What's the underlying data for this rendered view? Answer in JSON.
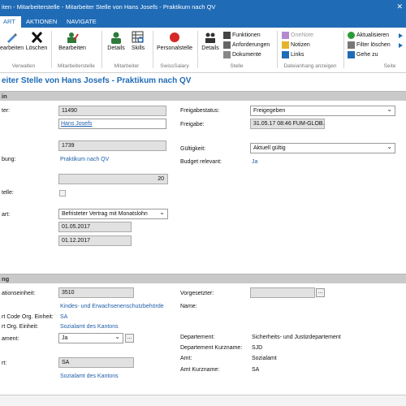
{
  "window": {
    "title": "iten - Mitarbeiterstelle - Mitarbeiter Stelle von Hans Josefs - Praktikum nach QV",
    "controls": "✕"
  },
  "tabs": [
    "ART",
    "AKTIONEN",
    "NAVIGATE"
  ],
  "ribbon": {
    "bearbeiten": "earbeiten",
    "loeschen": "Löschen",
    "group_verwalten": "Verwalten",
    "bearbeiten2": "Bearbeiten",
    "group_mitarbeiterstelle": "Mitarbeiterstelle",
    "details": "Details",
    "skills": "Skills",
    "group_mitarbeiter": "Mitarbeiter",
    "personalstelle": "Personalstelle",
    "group_swisssalary": "SwissSalary",
    "details2": "Details",
    "funktionen": "Funktionen",
    "anforderungen": "Anforderungen",
    "dokumente": "Dokumente",
    "group_stelle": "Stelle",
    "onenote": "OneNote",
    "notizen": "Notizen",
    "links": "Links",
    "group_dateianhang": "Dateianhang anzeigen",
    "aktualisieren": "Aktualisieren",
    "filter_loeschen": "Filter löschen",
    "gehe_zu": "Gehe zu",
    "group_seite": "Seite"
  },
  "page_title": "eiter Stelle von Hans Josefs - Praktikum nach QV",
  "section1": {
    "header": "in",
    "left": {
      "label1": "ter:",
      "value1": "11490",
      "link_name": "Hans Josefs",
      "value_code": "1739",
      "label_bez": "bung:",
      "link_bez": "Praktikum nach QV",
      "value_num": "20",
      "label_stelle": "telle:",
      "label_art": "art:",
      "vertrag": "Befristeter Vertrag mit Monatslohn",
      "date_from": "01.05.2017",
      "date_to": "01.12.2017"
    },
    "right": {
      "label_status": "Freigabestatus:",
      "status": "Freigegeben",
      "label_freigabe": "Freigabe:",
      "freigabe": "31.05.17 08:46 FUM-GLOB...",
      "label_gueltig": "Gültigkeit:",
      "gueltig": "Aktuell gültig",
      "label_budget": "Budget relevant:",
      "budget": "Ja"
    }
  },
  "section2": {
    "header": "ng",
    "left": {
      "label_orgeinheit": "ationseinheit:",
      "orgeinheit": "3510",
      "link_org": "Kindes- und Erwachsenenschutzbehörde",
      "label_kurzcode": "rt Code Org. Einheit:",
      "kurzcode": "SA",
      "label_orgeinh2": "rt Org. Einheit:",
      "link_amt": "Sozialamt des Kantons",
      "label_dept": "ament:",
      "dept": "Ja",
      "label_art2": "rt:",
      "art2": "SA",
      "link_amt2": "Sozialamt des Kantons"
    },
    "right": {
      "label_vorgesetzter": "Vorgesetzter:",
      "label_name": "Name:",
      "label_departement": "Departement:",
      "departement": "Sicherheits- und Justizdepartement",
      "label_dept_kurz": "Departement Kurzname:",
      "dept_kurz": "SJD",
      "label_amt": "Amt:",
      "amt": "Sozialamt",
      "label_amt_kurz": "Amt Kurzname:",
      "amt_kurz": "SA"
    }
  },
  "colors": {
    "accent": "#1f6bb6",
    "link": "#1f5eaa",
    "header_bg": "#c9c9c9"
  }
}
